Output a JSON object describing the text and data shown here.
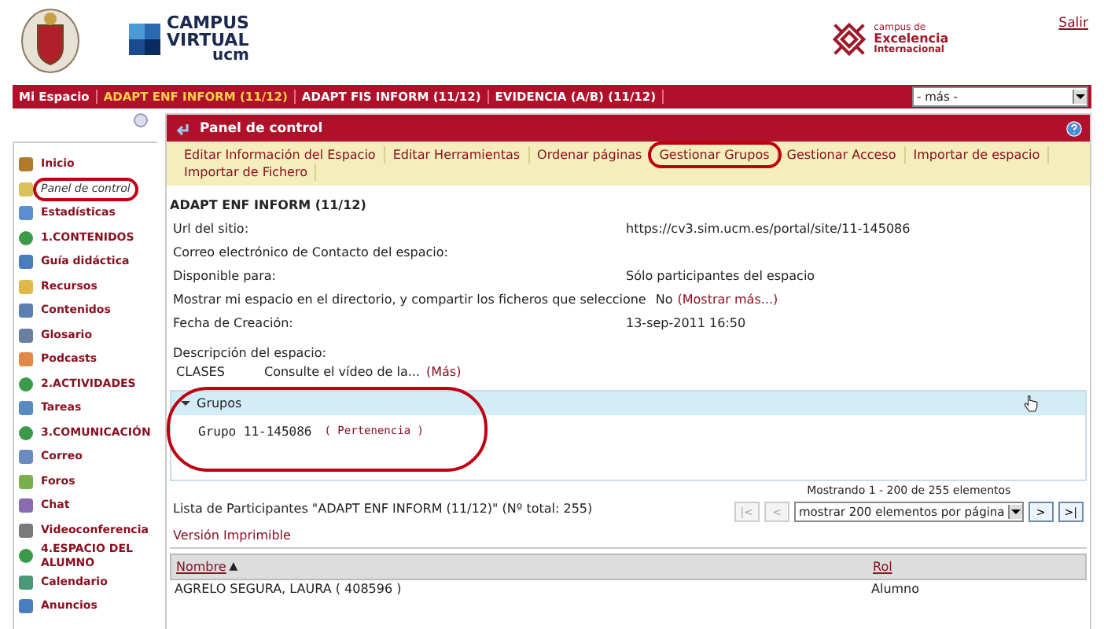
{
  "header": {
    "logo_campus": [
      "CAMPUS",
      "VIRTUAL",
      "ucm"
    ],
    "logo_excelencia": [
      "campus de",
      "Excelencia",
      "Internacional"
    ],
    "logout": "Salir"
  },
  "site_tabs": [
    {
      "label": "Mi Espacio",
      "selected": false
    },
    {
      "label": "ADAPT ENF INFORM (11/12)",
      "selected": true
    },
    {
      "label": "ADAPT FIS INFORM (11/12)",
      "selected": false
    },
    {
      "label": "EVIDENCIA (A/B) (11/12)",
      "selected": false
    }
  ],
  "more_select": {
    "value": "- más -"
  },
  "sidebar": {
    "items": [
      {
        "label": "Inicio",
        "kind": "home",
        "selected": false,
        "circled": false
      },
      {
        "label": "Panel de control",
        "kind": "panel",
        "selected": true,
        "circled": true
      },
      {
        "label": "Estadísticas",
        "kind": "stats",
        "selected": false,
        "circled": false
      },
      {
        "label": "1.CONTENIDOS",
        "kind": "section",
        "selected": false,
        "circled": false
      },
      {
        "label": "Guía didáctica",
        "kind": "page",
        "selected": false,
        "circled": false
      },
      {
        "label": "Recursos",
        "kind": "folder",
        "selected": false,
        "circled": false
      },
      {
        "label": "Contenidos",
        "kind": "link",
        "selected": false,
        "circled": false
      },
      {
        "label": "Glosario",
        "kind": "list",
        "selected": false,
        "circled": false
      },
      {
        "label": "Podcasts",
        "kind": "podcast",
        "selected": false,
        "circled": false
      },
      {
        "label": "2.ACTIVIDADES",
        "kind": "section",
        "selected": false,
        "circled": false
      },
      {
        "label": "Tareas",
        "kind": "edit",
        "selected": false,
        "circled": false
      },
      {
        "label": "3.COMUNICACIÓN",
        "kind": "section",
        "selected": false,
        "circled": false
      },
      {
        "label": "Correo",
        "kind": "mail",
        "selected": false,
        "circled": false
      },
      {
        "label": "Foros",
        "kind": "forum",
        "selected": false,
        "circled": false
      },
      {
        "label": "Chat",
        "kind": "chat",
        "selected": false,
        "circled": false
      },
      {
        "label": "Videoconferencia",
        "kind": "video",
        "selected": false,
        "circled": false
      },
      {
        "label": "4.ESPACIO DEL ALUMNO",
        "kind": "section",
        "selected": false,
        "circled": false
      },
      {
        "label": "Calendario",
        "kind": "calendar",
        "selected": false,
        "circled": false
      },
      {
        "label": "Anuncios",
        "kind": "page",
        "selected": false,
        "circled": false
      }
    ]
  },
  "panel": {
    "title": "Panel de control",
    "toolbar": [
      {
        "label": "Editar Información del Espacio",
        "circled": false
      },
      {
        "label": "Editar Herramientas",
        "circled": false
      },
      {
        "label": "Ordenar páginas",
        "circled": false
      },
      {
        "label": "Gestionar Grupos",
        "circled": true
      },
      {
        "label": "Gestionar Acceso",
        "circled": false
      },
      {
        "label": "Importar de espacio",
        "circled": false
      },
      {
        "label": "Importar de Fichero",
        "circled": false
      }
    ],
    "site_title": "ADAPT ENF INFORM (11/12)",
    "info_rows": [
      {
        "label": "Url del sitio:",
        "value": "https://cv3.sim.ucm.es/portal/site/11-145086"
      },
      {
        "label": "Correo electrónico de Contacto del espacio:"
      },
      {
        "label": "Disponible para:",
        "value": "Sólo participantes del espacio"
      },
      {
        "label": "Mostrar mi espacio en el directorio, y compartir los ficheros que seleccione",
        "value": "No",
        "link": "(Mostrar más...)"
      },
      {
        "label": "Fecha de Creación:",
        "value": "13-sep-2011 16:50"
      }
    ],
    "description": {
      "label": "Descripción del espacio:",
      "term": "CLASES",
      "text": "Consulte el vídeo de la...",
      "link": "(Más)"
    },
    "groups": {
      "title": "Grupos",
      "expanded": true,
      "circled": true,
      "items": [
        {
          "name": "Grupo 11-145086",
          "link": "( Pertenencia )"
        }
      ]
    },
    "participants": {
      "title": "Lista de Participantes \"ADAPT ENF INFORM (11/12)\" (Nº total: 255)",
      "printable": "Versión Imprimible",
      "paging": {
        "status": "Mostrando 1 - 200 de 255 elementos",
        "page_size": "mostrar 200 elementos por página",
        "buttons": [
          {
            "label": "|<",
            "disabled": true
          },
          {
            "label": "<",
            "disabled": true
          }
        ],
        "buttons_after": [
          {
            "label": ">",
            "disabled": false
          },
          {
            "label": ">|",
            "disabled": false
          }
        ]
      },
      "columns": [
        {
          "label": "Nombre",
          "sort": "▲"
        },
        {
          "label": "Rol"
        }
      ],
      "rows": [
        [
          "AGRELO SEGURA, LAURA ( 408596 )",
          "Alumno"
        ]
      ]
    }
  }
}
